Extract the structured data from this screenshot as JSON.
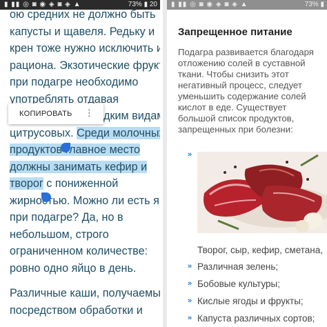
{
  "left_panel": {
    "status_bar": {
      "icons": "▮ ▮▮ ◎ ◙ ◉ ◈ ◙ ◈ ▲",
      "right": "73%",
      "time": "20"
    },
    "article_lines": [
      "ою средних не должно быть",
      "капусты и щавеля. Редьку и",
      "крен тоже нужно исключить из",
      "рациона. Экзотические фрукты",
      "при подагре необходимо",
      "употреблять отдавая",
      "предпочтение сладким видам",
      "цитрусовых.",
      "Среди молочных",
      "продуктов главное место",
      "должны занимать кефир и",
      "творог",
      "с пониженной",
      "жирностью. Можно ли есть яйца",
      "при подагре? Да, но в",
      "небольшом, строго",
      "ограниченном количестве:",
      "ровно одно яйцо в день."
    ],
    "article_para2": [
      "Различные каши, получаемые",
      "посредством обработки и"
    ],
    "copy_menu": {
      "label": "КОПИРОВАТЬ",
      "more": "⋮"
    }
  },
  "right_panel": {
    "status_bar": {
      "icons": "▮ ▮▮ ◎ ◙ ◉ ◈ ◙ ◈ ▲",
      "right": "73%"
    },
    "title": "Запрещенное питание",
    "intro_lines": [
      "Подагра развивается благодаря",
      "отложению солей в суставной",
      "ткани. Чтобы снизить этот",
      "негативный процесс, следует",
      "уменьшить содержание солей",
      "кислот в еде. Существует",
      "большой список продуктов,",
      "запрещенных при болезни:"
    ],
    "bullets": [
      "Творог, сыр, кефир, сметана,",
      "Различная зелень;",
      "Бобовые культуры;",
      "Кислые ягоды и фрукты;",
      "Капуста различных сортов;"
    ],
    "bullet_mark": "»"
  },
  "colors": {
    "text_left": "#1f4f66",
    "selection": "#b9dcf3",
    "handle": "#2a6fd6",
    "bullet": "#2d7ac0"
  }
}
